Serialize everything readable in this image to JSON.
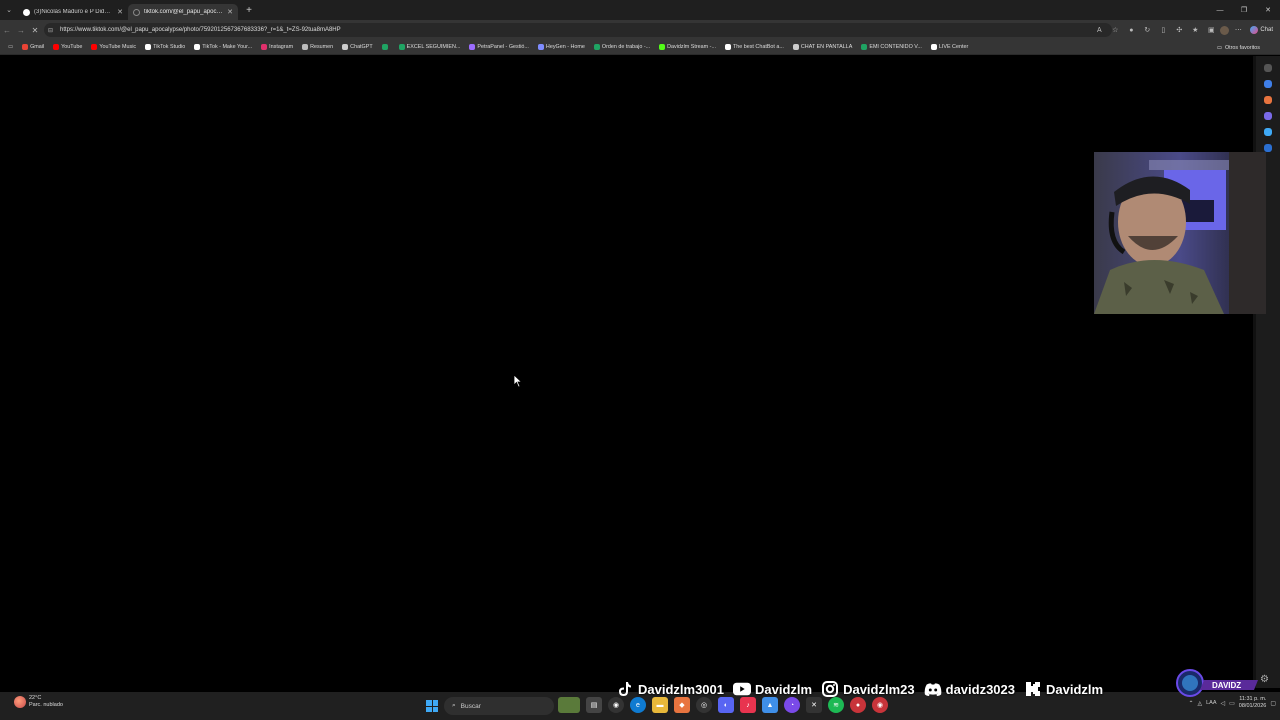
{
  "browser": {
    "tabs": [
      {
        "title": "(3)Nicolás Maduro e P Diddy: Um...",
        "active": false
      },
      {
        "title": "tiktok.com/@el_papu_apocalypse",
        "active": true
      }
    ],
    "new_tab": "+",
    "url": "https://www.tiktok.com/@el_papu_apocalypse/photo/7592012567367683336?_r=1&_t=ZS-92tua8mA8HP",
    "chat_label": "Chat"
  },
  "bookmarks": {
    "items": [
      {
        "label": "Gmail",
        "color": "#ea4335"
      },
      {
        "label": "YouTube",
        "color": "#ff0000"
      },
      {
        "label": "YouTube Music",
        "color": "#ff0000"
      },
      {
        "label": "TikTok Studio",
        "color": "#ffffff"
      },
      {
        "label": "TikTok - Make Your...",
        "color": "#ffffff"
      },
      {
        "label": "Instagram",
        "color": "#e1306c"
      },
      {
        "label": "Resumen",
        "color": "#bbbbbb"
      },
      {
        "label": "ChatGPT",
        "color": "#cccccc"
      },
      {
        "label": "",
        "color": "#1fa463"
      },
      {
        "label": "EXCEL SEGUIMIEN...",
        "color": "#1fa463"
      },
      {
        "label": "PetraPanel - Gestió...",
        "color": "#9b6cff"
      },
      {
        "label": "HeyGen - Home",
        "color": "#7f8cff"
      },
      {
        "label": "Orden de trabajo -...",
        "color": "#1fa463"
      },
      {
        "label": "Davidzlm Stream -...",
        "color": "#53fc18"
      },
      {
        "label": "The best ChatBot a...",
        "color": "#ffffff"
      },
      {
        "label": "CHAT EN PANTALLA",
        "color": "#cccccc"
      },
      {
        "label": "EMI CONTENIDO V...",
        "color": "#1fa463"
      },
      {
        "label": "LIVE Center",
        "color": "#ffffff"
      }
    ],
    "other_label": "Otros favoritos"
  },
  "taskbar": {
    "weather_temp": "22°C",
    "weather_desc": "Parc. nublado",
    "search_placeholder": "Buscar",
    "lang": "LAA",
    "time": "11:31 p. m.",
    "date": "08/01/2026"
  },
  "socials": [
    {
      "platform": "tiktok",
      "handle": "Davidzlm3001"
    },
    {
      "platform": "youtube",
      "handle": "Davidzlm"
    },
    {
      "platform": "instagram",
      "handle": "Davidzlm23"
    },
    {
      "platform": "discord",
      "handle": "davidz3023"
    },
    {
      "platform": "kick",
      "handle": "Davidzlm"
    }
  ],
  "brand": {
    "label": "DAVIDZ"
  },
  "colors": {
    "accent": "#3fa9f5",
    "kick": "#53fc18",
    "background": "#000000"
  }
}
